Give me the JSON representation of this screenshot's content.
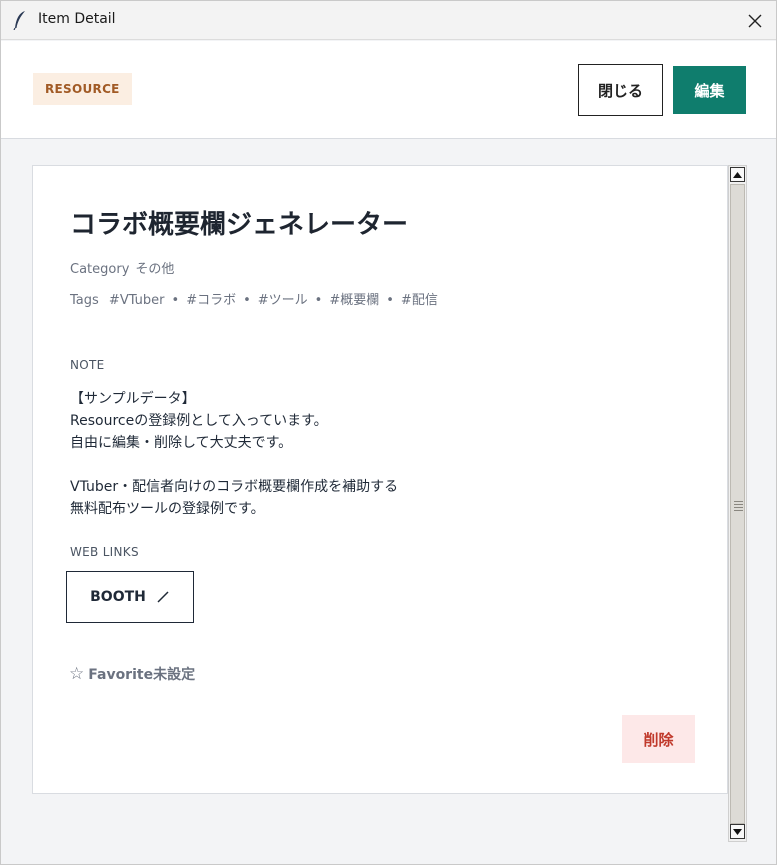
{
  "window": {
    "title": "Item Detail"
  },
  "header": {
    "type_badge": "RESOURCE",
    "close_label": "閉じる",
    "edit_label": "編集"
  },
  "item": {
    "title": "コラボ概要欄ジェネレーター",
    "category_label": "Category",
    "category_value": "その他",
    "tags_label": "Tags",
    "tags": [
      "#VTuber",
      "#コラボ",
      "#ツール",
      "#概要欄",
      "#配信"
    ],
    "note_label": "NOTE",
    "note_text": "【サンプルデータ】\nResourceの登録例として入っています。\n自由に編集・削除して大丈夫です。\n\nVTuber・配信者向けのコラボ概要欄作成を補助する\n無料配布ツールの登録例です。",
    "links_label": "WEB LINKS",
    "links": [
      {
        "label": "BOOTH",
        "icon": "external-link-icon"
      }
    ],
    "favorite_star": "☆",
    "favorite_label": "Favorite未設定",
    "delete_label": "削除"
  },
  "colors": {
    "accent": "#0f7d6d",
    "badge_bg": "#fbeee2",
    "badge_text": "#a15a25",
    "danger_bg": "#fde8e8",
    "danger_text": "#c0392b"
  }
}
